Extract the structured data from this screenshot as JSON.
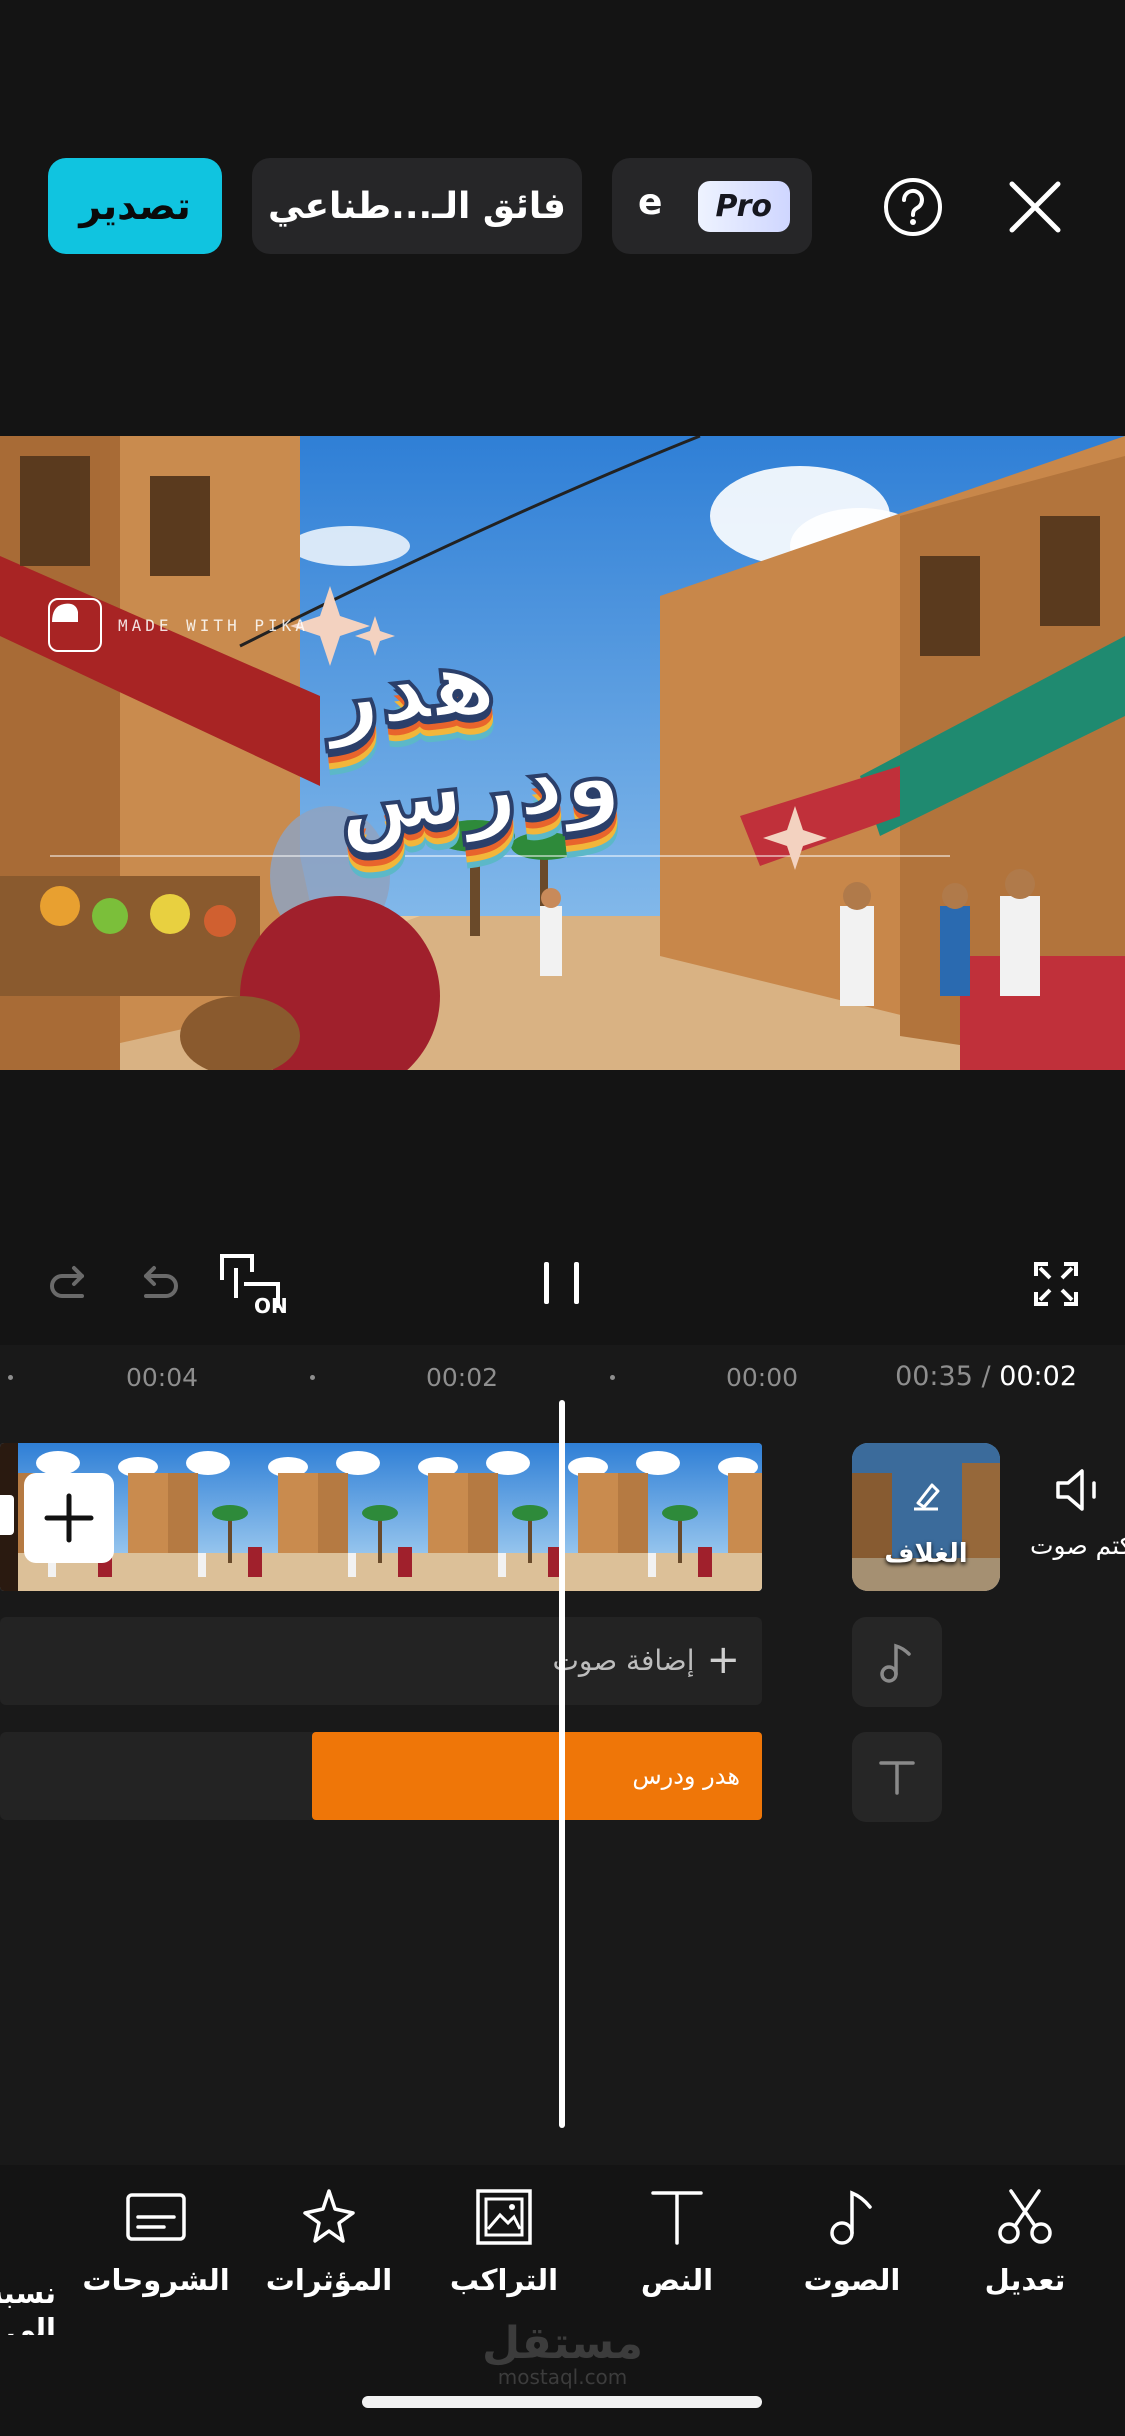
{
  "topbar": {
    "export_label": "تصدير",
    "ai_label": "فائق الـ...طناعي",
    "pro_fade_text": "e",
    "pro_badge": "Pro"
  },
  "preview": {
    "watermark_text": "MADE WITH PIKA",
    "title_text": "هدر ودرس"
  },
  "controls": {
    "sync_badge": "ON"
  },
  "timeline": {
    "ticks": [
      "00:04",
      "00:02",
      "00:00"
    ],
    "current_time": "00:02",
    "separator": "/",
    "total_time": "00:35",
    "cover_label": "الغلاف",
    "mute_label": "كتم صوت",
    "audio_add_label": "إضافة صوت",
    "text_clip_label": "هدر ودرس"
  },
  "toolbar": {
    "items": [
      {
        "label": "تعديل",
        "icon": "scissors-icon"
      },
      {
        "label": "الصوت",
        "icon": "music-note-icon"
      },
      {
        "label": "النص",
        "icon": "text-icon"
      },
      {
        "label": "التراكب",
        "icon": "overlay-icon"
      },
      {
        "label": "المؤثرات",
        "icon": "effects-star-icon"
      },
      {
        "label": "الشروحات",
        "icon": "captions-icon"
      }
    ],
    "cut_label_line1": "نسبة",
    "cut_label_line2": "إلى"
  },
  "brand": {
    "ar": "مستقل",
    "en": "mostaql.com"
  },
  "colors": {
    "accent": "#10c4e0",
    "text_clip": "#ef7608",
    "background": "#141414"
  }
}
